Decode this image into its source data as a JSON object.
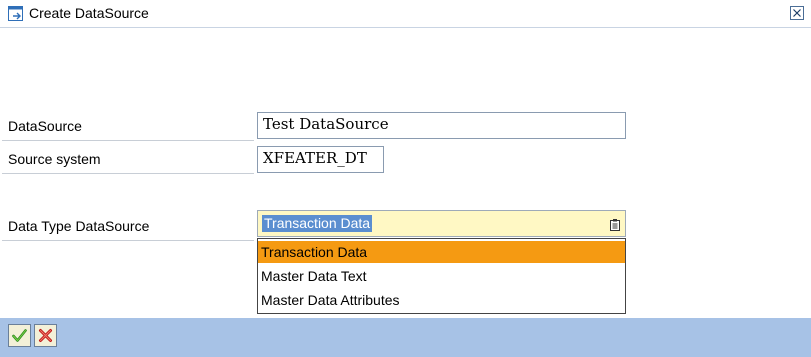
{
  "dialog": {
    "title": "Create DataSource"
  },
  "form": {
    "datasource_label": "DataSource",
    "datasource_value": "Test DataSource",
    "source_system_label": "Source system",
    "source_system_value": "XFEATER_DT",
    "data_type_label": "Data Type DataSource",
    "data_type_value": "Transaction Data"
  },
  "data_type_options": [
    "Transaction Data",
    "Master Data Text",
    "Master Data Attributes"
  ],
  "colors": {
    "footer": "#a7c2e6",
    "selected_option": "#f59a12",
    "dropdown_bg": "#fff8c4",
    "text_highlight": "#5b8ed0"
  },
  "icons": {
    "title": "dialog-window-icon",
    "close": "close-icon",
    "dropdown": "value-help-icon",
    "confirm": "checkmark-icon",
    "cancel": "cross-icon"
  }
}
